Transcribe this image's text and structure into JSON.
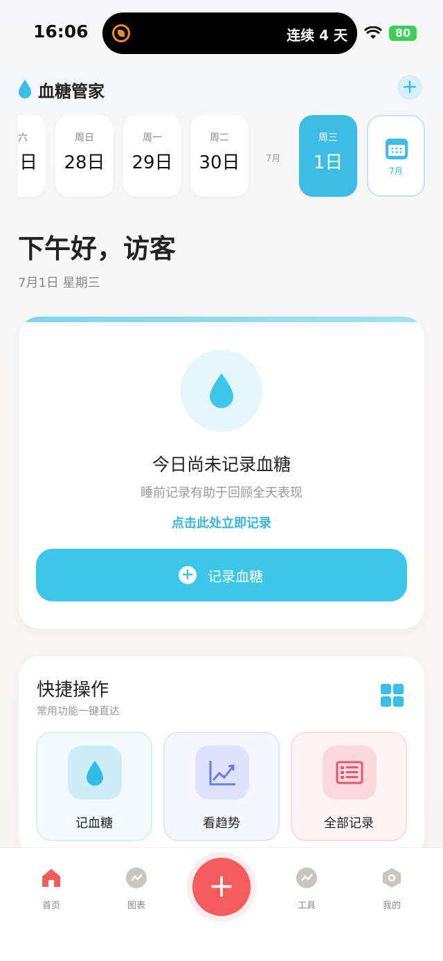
{
  "status_bar": {
    "time": "16:06",
    "streak": "连续 4 天",
    "battery": "80"
  },
  "header": {
    "title": "血糖管家",
    "add_symbol": "+"
  },
  "date_strip": {
    "partial_day": {
      "weekday": "六",
      "date": "日"
    },
    "days": [
      {
        "weekday": "周日",
        "date": "28日"
      },
      {
        "weekday": "周一",
        "date": "29日"
      },
      {
        "weekday": "周二",
        "date": "30日"
      }
    ],
    "month_separator": "7月",
    "selected": {
      "weekday": "周三",
      "date": "1日"
    },
    "calendar_label": "7月"
  },
  "greeting": {
    "text": "下午好，访客",
    "date": "7月1日 星期三"
  },
  "record_card": {
    "title": "今日尚未记录血糖",
    "subtitle": "睡前记录有助于回顾全天表现",
    "link": "点击此处立即记录",
    "button_label": "记录血糖"
  },
  "quick_actions": {
    "title": "快捷操作",
    "subtitle": "常用功能一键直达",
    "items": [
      {
        "label": "记血糖",
        "icon": "water-drop-icon"
      },
      {
        "label": "看趋势",
        "icon": "trend-chart-icon"
      },
      {
        "label": "全部记录",
        "icon": "list-record-icon"
      }
    ]
  },
  "bottom_nav": {
    "items": [
      {
        "label": "首页",
        "icon": "home-icon"
      },
      {
        "label": "图表",
        "icon": "chart-icon"
      },
      {
        "label": "工具",
        "icon": "tools-icon"
      },
      {
        "label": "我的",
        "icon": "profile-icon"
      }
    ],
    "fab_symbol": "+"
  },
  "colors": {
    "accent": "#3bbde6",
    "fab": "#f45b5b",
    "home_active": "#f45b5b"
  }
}
